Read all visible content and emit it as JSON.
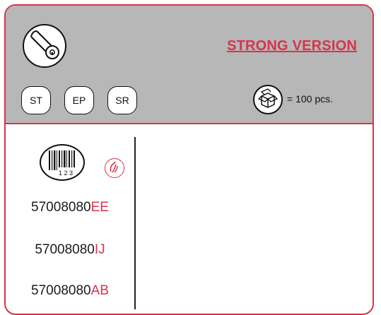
{
  "header": {
    "version_title": "STRONG VERSION",
    "types": [
      "ST",
      "EP",
      "SR"
    ],
    "packaging": {
      "icon": "box-icon",
      "text": "= 100 pcs."
    },
    "product_icon": "cylinder-lock-icon"
  },
  "codes": [
    {
      "base": "57008080",
      "suffix": "EE"
    },
    {
      "base": "57008080",
      "suffix": "IJ"
    },
    {
      "base": "57008080",
      "suffix": "AB"
    }
  ],
  "icons": {
    "barcode": "barcode-icon",
    "barcode_digits": "1 2 3",
    "hand": "hand-icon"
  },
  "colors": {
    "accent": "#d8344a",
    "header_bg": "#b7b7b7"
  }
}
